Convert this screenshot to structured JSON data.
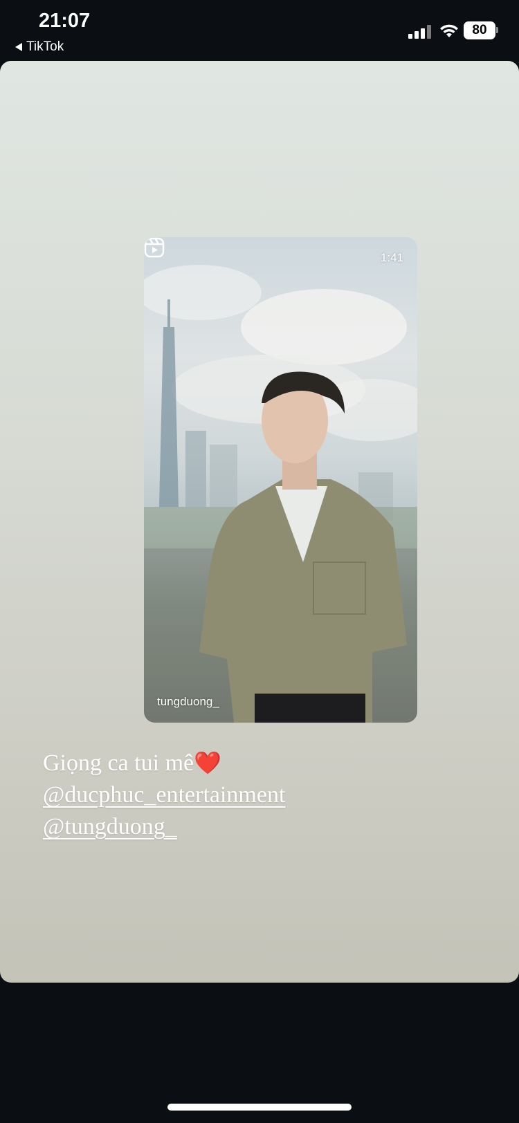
{
  "status_bar": {
    "time": "21:07",
    "back_app": "TikTok",
    "battery": "80"
  },
  "reel": {
    "duration": "1:41",
    "username": "tungduong_",
    "icon": "reels-icon"
  },
  "caption": {
    "text": "Giọng ca tui mê",
    "emoji": "❤️",
    "mention_1": "@ducphuc_entertainment",
    "mention_2": "@tungduong_"
  },
  "colors": {
    "background": "#0b0e13",
    "card_top": "#e0e6e2",
    "card_bottom": "#c4c3b8",
    "heart": "#e3202e"
  }
}
